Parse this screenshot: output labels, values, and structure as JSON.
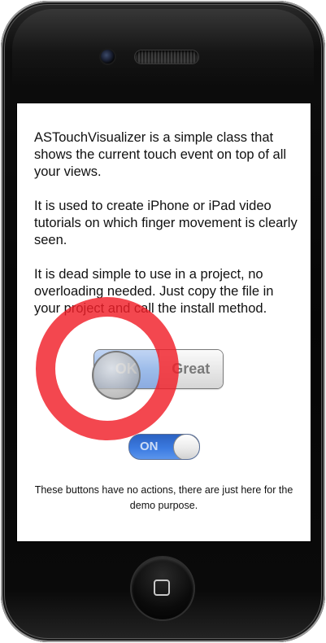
{
  "screen": {
    "paragraphs": [
      "ASTouchVisualizer is a simple class that shows the current touch event on top of all your views.",
      "It is used to create iPhone or iPad video tutorials on which finger movement is clearly seen.",
      "It is dead simple to use in a project, no overloading needed. Just copy the file in your project and call the install method."
    ],
    "segmented": {
      "segments": [
        "OK",
        "Great"
      ],
      "selected": "OK"
    },
    "switch": {
      "label": "ON",
      "state": "on"
    },
    "footnote": "These buttons have no actions, there are just here for the demo purpose."
  },
  "colors": {
    "touch_ring": "#F01E28",
    "segment_selected": "#4D86D9",
    "switch_on": "#3B7AE0"
  },
  "icons": {
    "device_camera": "camera-icon",
    "home_button_glyph": "home-square-icon"
  }
}
